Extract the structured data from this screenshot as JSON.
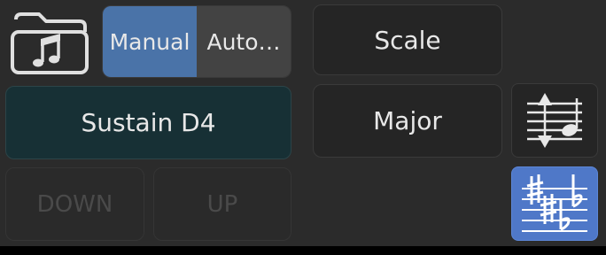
{
  "folder": {
    "icon": "folder-music-icon"
  },
  "mode": {
    "options": [
      "Manual",
      "Auto…"
    ],
    "selected": "Manual",
    "accent": "#4a73a8"
  },
  "scale_button": {
    "label": "Scale"
  },
  "sustain_button": {
    "label": "Sustain D4",
    "bg": "#173035"
  },
  "scale_type_button": {
    "label": "Major"
  },
  "transpose_icon": {
    "icon": "transpose-staff-icon"
  },
  "down_button": {
    "label": "DOWN"
  },
  "up_button": {
    "label": "UP"
  },
  "accidentals_button": {
    "icon": "sharps-flats-icon",
    "bg": "#4f78c8"
  }
}
